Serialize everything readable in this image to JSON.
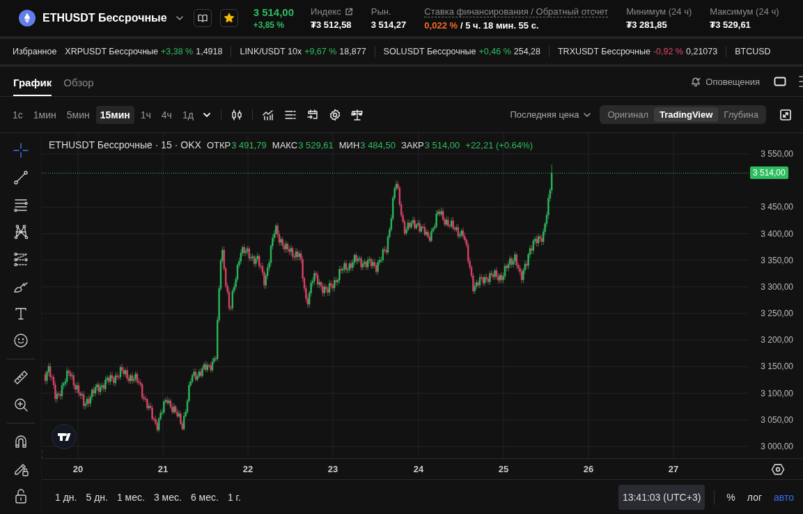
{
  "header": {
    "symbol": "ETHUSDT Бессрочные",
    "favorite": true,
    "price": "3 514,00",
    "change": "+3,85 %",
    "stats": [
      {
        "kind": "link",
        "label": "Индекс",
        "value": "₮3 512,58"
      },
      {
        "kind": "plain",
        "label": "Рын.",
        "value": "3 514,27"
      },
      {
        "kind": "funding",
        "label": "Ставка финансирования / Обратный отсчет",
        "rate": "0,022 %",
        "value": "/ 5 ч. 18 мин. 55 с."
      },
      {
        "kind": "plain",
        "label": "Минимум (24 ч)",
        "value": "₮3 281,85"
      },
      {
        "kind": "plain",
        "label": "Максимум (24 ч)",
        "value": "₮3 529,61"
      }
    ]
  },
  "favorites": {
    "label": "Избранное",
    "items": [
      {
        "name": "XRPUSDT Бессрочные",
        "change": "+3,38 %",
        "color": "#2ebd5f",
        "price": "1,4918"
      },
      {
        "name": "LINK/USDT 10x",
        "change": "+9,67 %",
        "color": "#2ebd5f",
        "price": "18,877"
      },
      {
        "name": "SOLUSDT Бессрочные",
        "change": "+0,46 %",
        "color": "#2ebd5f",
        "price": "254,28"
      },
      {
        "name": "TRXUSDT Бессрочные",
        "change": "-0,92 %",
        "color": "#e0466a",
        "price": "0,21073"
      },
      {
        "name": "BTCUSD"
      }
    ]
  },
  "tabs": [
    {
      "label": "График",
      "selected": true
    },
    {
      "label": "Обзор",
      "selected": false
    }
  ],
  "alerts": "Оповещения",
  "intervals": [
    {
      "label": "1с",
      "selected": false
    },
    {
      "label": "1мин",
      "selected": false
    },
    {
      "label": "5мин",
      "selected": false
    },
    {
      "label": "15мин",
      "selected": true
    },
    {
      "label": "1ч",
      "selected": false
    },
    {
      "label": "4ч",
      "selected": false
    },
    {
      "label": "1д",
      "selected": false
    }
  ],
  "price_type": "Последняя цена",
  "views": [
    {
      "label": "Оригинал",
      "selected": false
    },
    {
      "label": "TradingView",
      "selected": true
    },
    {
      "label": "Глубина",
      "selected": false
    }
  ],
  "tools": [
    {
      "kind": "crosshair",
      "selected": true
    },
    {
      "kind": "line",
      "selected": false
    },
    {
      "kind": "hlines",
      "selected": false
    },
    {
      "kind": "pattern",
      "selected": false
    },
    {
      "kind": "fib",
      "selected": false
    },
    {
      "kind": "brush",
      "selected": false
    },
    {
      "kind": "text",
      "selected": false
    },
    {
      "kind": "smiley",
      "selected": false
    },
    {
      "kind": "divider"
    },
    {
      "kind": "ruler",
      "selected": false
    },
    {
      "kind": "zoom",
      "selected": false
    },
    {
      "kind": "divider"
    },
    {
      "kind": "magnet",
      "selected": false
    },
    {
      "kind": "pencil_lock",
      "selected": false
    },
    {
      "kind": "unlock",
      "selected": false
    }
  ],
  "chart": {
    "title": "ETHUSDT Бессрочные · 15 · OKX",
    "ohlc": [
      {
        "label": "ОТКР",
        "value": "3 491,79"
      },
      {
        "label": "МАКС",
        "value": "3 529,61"
      },
      {
        "label": "МИН",
        "value": "3 484,50"
      },
      {
        "label": "ЗАКР",
        "value": "3 514,00"
      }
    ],
    "change": "+22,21 (+0.64%)",
    "last_price": "3 514,00",
    "price_ticks": [
      "3 550,00",
      "3 450,00",
      "3 400,00",
      "3 350,00",
      "3 300,00",
      "3 250,00",
      "3 200,00",
      "3 150,00",
      "3 100,00",
      "3 050,00",
      "3 000,00"
    ],
    "date_ticks": [
      "20",
      "21",
      "22",
      "23",
      "24",
      "25",
      "26",
      "27"
    ]
  },
  "ranges": [
    "1 дн.",
    "5 дн.",
    "1 мес.",
    "3 мес.",
    "6 мес.",
    "1 г."
  ],
  "time": "13:41:03 (UTC+3)",
  "scales": [
    {
      "label": "%",
      "on": false
    },
    {
      "label": "лог",
      "on": false
    },
    {
      "label": "авто",
      "on": true
    }
  ]
}
